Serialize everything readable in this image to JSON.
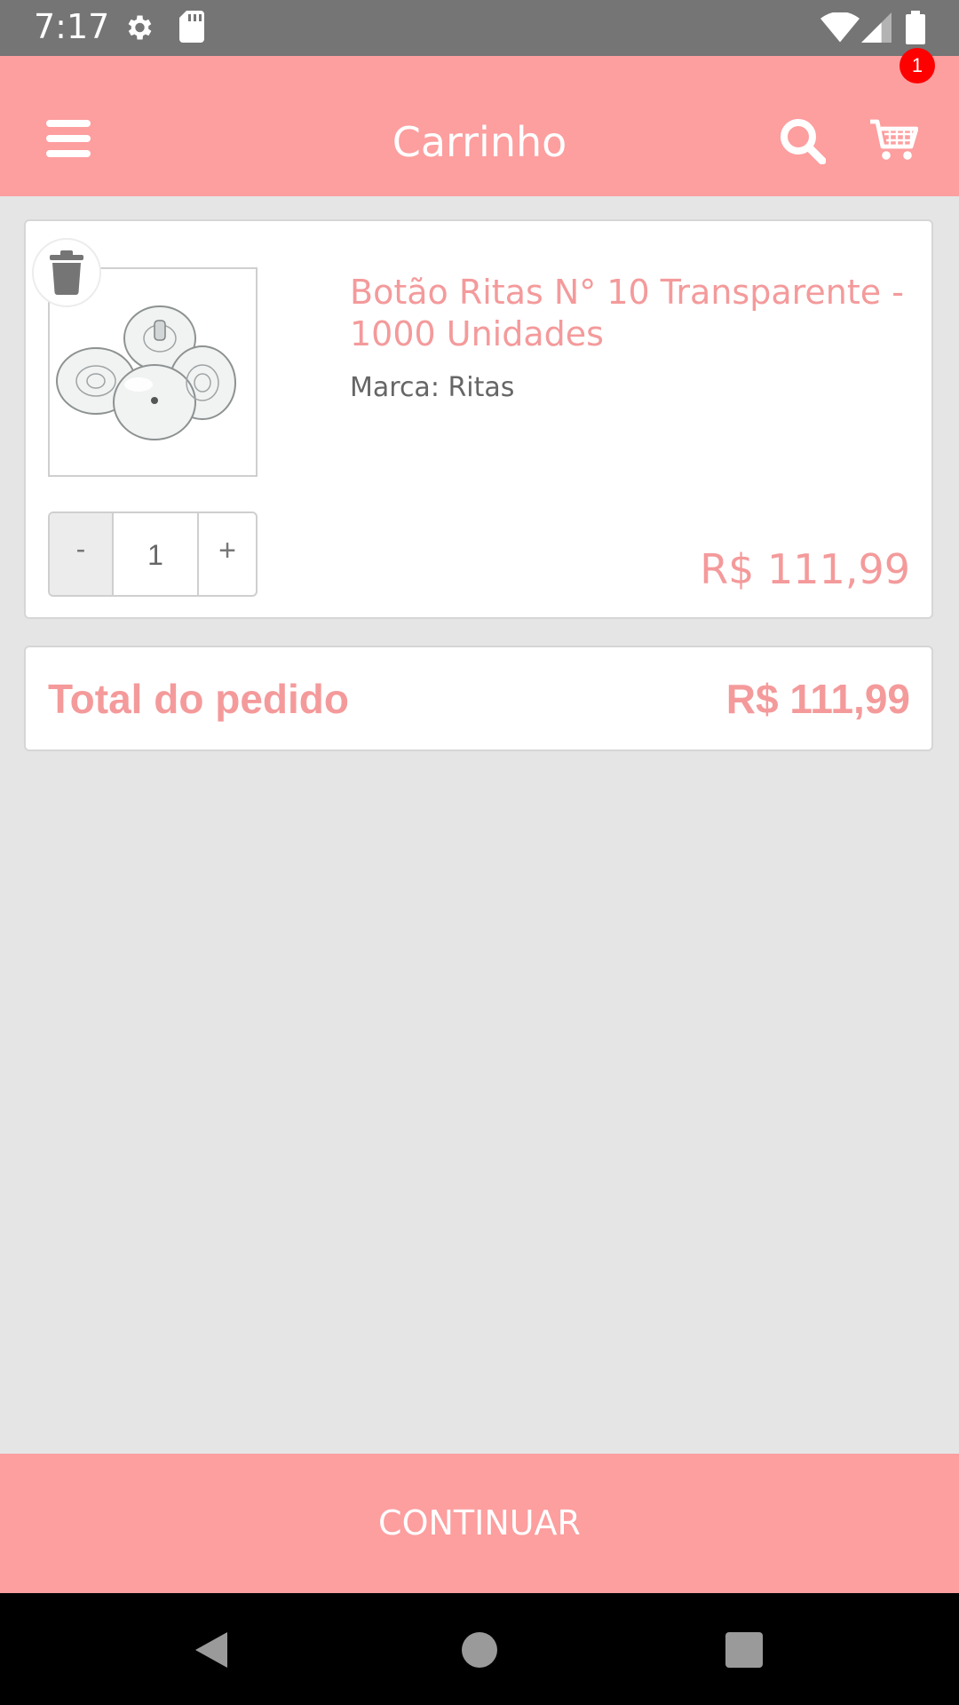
{
  "status_bar": {
    "time": "7:17"
  },
  "app_bar": {
    "title": "Carrinho",
    "cart_count": "1"
  },
  "cart_item": {
    "name": "Botão Ritas N° 10 Transparente - 1000 Unidades",
    "brand": "Marca: Ritas",
    "quantity": "1",
    "minus_label": "-",
    "plus_label": "+",
    "price": "R$ 111,99"
  },
  "summary": {
    "total_label": "Total do pedido",
    "total_value": "R$ 111,99"
  },
  "actions": {
    "continue_label": "CONTINUAR"
  },
  "colors": {
    "accent": "#fd9e9f",
    "price_text": "#f49a9b",
    "badge": "#ff0000"
  }
}
